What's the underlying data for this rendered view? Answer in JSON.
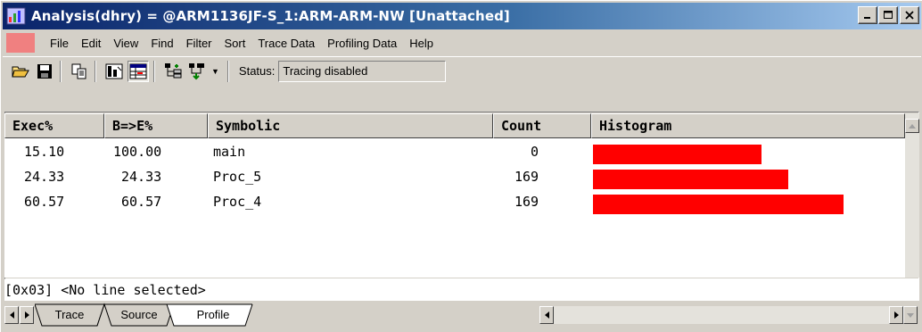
{
  "window": {
    "title": "Analysis(dhry) = @ARM1136JF-S_1:ARM-ARM-NW [Unattached]"
  },
  "menu": {
    "items": [
      "File",
      "Edit",
      "View",
      "Find",
      "Filter",
      "Sort",
      "Trace Data",
      "Profiling Data",
      "Help"
    ]
  },
  "toolbar": {
    "status_label": "Status:",
    "status_value": "Tracing disabled"
  },
  "table": {
    "columns": [
      "Exec%",
      "B=>E%",
      "Symbolic",
      "Count",
      "Histogram"
    ],
    "rows": [
      {
        "exec": "15.10",
        "b_to_e": "100.00",
        "symbolic": "main",
        "count": "0",
        "hist": 0.35
      },
      {
        "exec": "24.33",
        "b_to_e": "24.33",
        "symbolic": "Proc_5",
        "count": "169",
        "hist": 0.406
      },
      {
        "exec": "60.57",
        "b_to_e": "60.57",
        "symbolic": "Proc_4",
        "count": "169",
        "hist": 0.52
      }
    ]
  },
  "status_line": "[0x03] <No line selected>",
  "tabs": [
    "Trace",
    "Source",
    "Profile"
  ],
  "colors": {
    "histogram_bar": "#ff0000",
    "titlebar_start": "#0a246a",
    "titlebar_end": "#a6caf0",
    "menu_swatch": "#f08080"
  }
}
